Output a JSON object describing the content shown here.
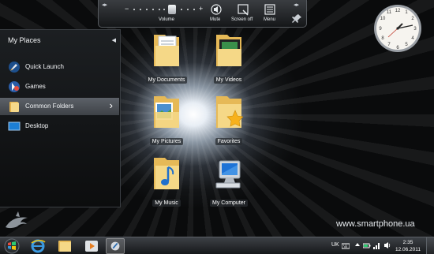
{
  "toolbar": {
    "volume_label": "Volume",
    "mute_label": "Mute",
    "screen_off_label": "Screen off",
    "menu_label": "Menu",
    "minus": "−",
    "plus": "+"
  },
  "sidebar": {
    "title": "My Places",
    "items": [
      {
        "label": "Quick Launch",
        "icon": "rocket-icon",
        "active": false
      },
      {
        "label": "Games",
        "icon": "games-icon",
        "active": false
      },
      {
        "label": "Common Folders",
        "icon": "folder-icon",
        "active": true
      },
      {
        "label": "Desktop",
        "icon": "desktop-icon",
        "active": false
      }
    ]
  },
  "desktop_icons": [
    {
      "label": "My Documents",
      "icon": "documents-folder-icon"
    },
    {
      "label": "My Videos",
      "icon": "videos-folder-icon"
    },
    {
      "label": "My Pictures",
      "icon": "pictures-folder-icon"
    },
    {
      "label": "Favorites",
      "icon": "favorites-folder-icon"
    },
    {
      "label": "My Music",
      "icon": "music-folder-icon"
    },
    {
      "label": "My Computer",
      "icon": "computer-icon"
    }
  ],
  "watermark": "www.smartphone.ua",
  "taskbar": {
    "apps": [
      "internet-explorer-icon",
      "explorer-folder-icon",
      "media-player-icon",
      "spb-shell-icon"
    ],
    "language": "UK",
    "time": "2:35",
    "date": "12.06.2011"
  },
  "colors": {
    "active_item": "#50555b",
    "folder_yellow": "#f3d27a",
    "accent_blue": "#2e8fe0"
  }
}
